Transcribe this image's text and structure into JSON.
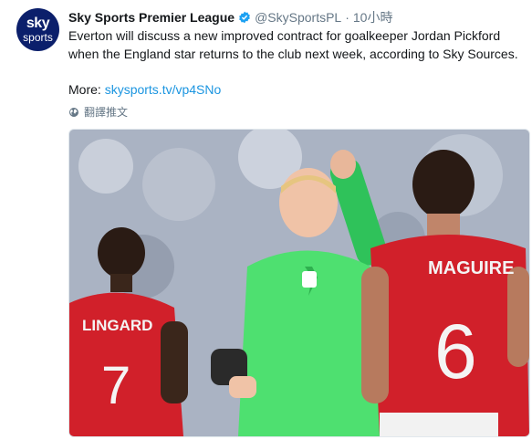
{
  "account": {
    "avatar_line1": "sky",
    "avatar_line2": "sports",
    "name": "Sky Sports Premier League",
    "handle": "@SkySportsPL",
    "separator": "·",
    "time": "10小時"
  },
  "tweet": {
    "text": "Everton will discuss a new improved contract for goalkeeper Jordan Pickford when the England star returns to the club next week, according to Sky Sources.",
    "more_label": "More: ",
    "link_text": "skysports.tv/vp4SNo",
    "translate_label": "翻譯推文"
  },
  "photo": {
    "jersey_left_name": "LINGARD",
    "jersey_left_number": "7",
    "jersey_right_name": "MAGUIRE",
    "jersey_right_number": "6"
  },
  "colors": {
    "verified": "#1da1f2",
    "link": "#1b95e0",
    "secondary_text": "#657786",
    "avatar_bg": "#0b1f6b"
  }
}
